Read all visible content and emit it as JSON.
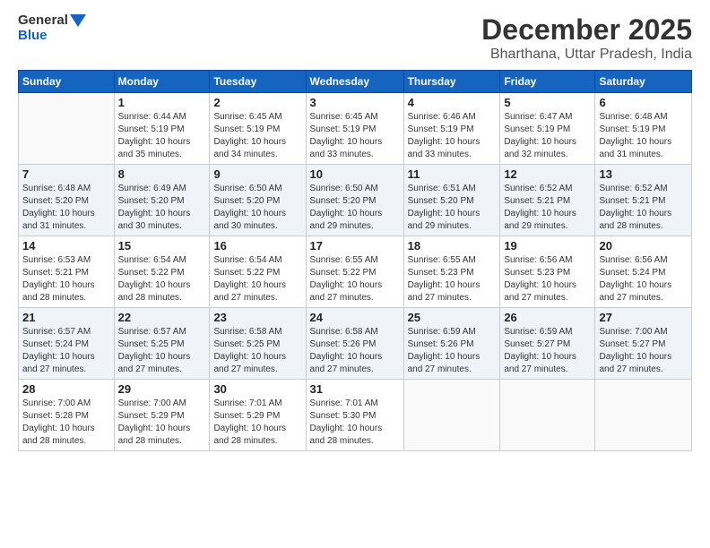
{
  "logo": {
    "line1": "General",
    "line2": "Blue"
  },
  "title": "December 2025",
  "subtitle": "Bharthana, Uttar Pradesh, India",
  "weekdays": [
    "Sunday",
    "Monday",
    "Tuesday",
    "Wednesday",
    "Thursday",
    "Friday",
    "Saturday"
  ],
  "rows": [
    [
      {
        "day": "",
        "info": ""
      },
      {
        "day": "1",
        "info": "Sunrise: 6:44 AM\nSunset: 5:19 PM\nDaylight: 10 hours\nand 35 minutes."
      },
      {
        "day": "2",
        "info": "Sunrise: 6:45 AM\nSunset: 5:19 PM\nDaylight: 10 hours\nand 34 minutes."
      },
      {
        "day": "3",
        "info": "Sunrise: 6:45 AM\nSunset: 5:19 PM\nDaylight: 10 hours\nand 33 minutes."
      },
      {
        "day": "4",
        "info": "Sunrise: 6:46 AM\nSunset: 5:19 PM\nDaylight: 10 hours\nand 33 minutes."
      },
      {
        "day": "5",
        "info": "Sunrise: 6:47 AM\nSunset: 5:19 PM\nDaylight: 10 hours\nand 32 minutes."
      },
      {
        "day": "6",
        "info": "Sunrise: 6:48 AM\nSunset: 5:19 PM\nDaylight: 10 hours\nand 31 minutes."
      }
    ],
    [
      {
        "day": "7",
        "info": "Sunrise: 6:48 AM\nSunset: 5:20 PM\nDaylight: 10 hours\nand 31 minutes."
      },
      {
        "day": "8",
        "info": "Sunrise: 6:49 AM\nSunset: 5:20 PM\nDaylight: 10 hours\nand 30 minutes."
      },
      {
        "day": "9",
        "info": "Sunrise: 6:50 AM\nSunset: 5:20 PM\nDaylight: 10 hours\nand 30 minutes."
      },
      {
        "day": "10",
        "info": "Sunrise: 6:50 AM\nSunset: 5:20 PM\nDaylight: 10 hours\nand 29 minutes."
      },
      {
        "day": "11",
        "info": "Sunrise: 6:51 AM\nSunset: 5:20 PM\nDaylight: 10 hours\nand 29 minutes."
      },
      {
        "day": "12",
        "info": "Sunrise: 6:52 AM\nSunset: 5:21 PM\nDaylight: 10 hours\nand 29 minutes."
      },
      {
        "day": "13",
        "info": "Sunrise: 6:52 AM\nSunset: 5:21 PM\nDaylight: 10 hours\nand 28 minutes."
      }
    ],
    [
      {
        "day": "14",
        "info": "Sunrise: 6:53 AM\nSunset: 5:21 PM\nDaylight: 10 hours\nand 28 minutes."
      },
      {
        "day": "15",
        "info": "Sunrise: 6:54 AM\nSunset: 5:22 PM\nDaylight: 10 hours\nand 28 minutes."
      },
      {
        "day": "16",
        "info": "Sunrise: 6:54 AM\nSunset: 5:22 PM\nDaylight: 10 hours\nand 27 minutes."
      },
      {
        "day": "17",
        "info": "Sunrise: 6:55 AM\nSunset: 5:22 PM\nDaylight: 10 hours\nand 27 minutes."
      },
      {
        "day": "18",
        "info": "Sunrise: 6:55 AM\nSunset: 5:23 PM\nDaylight: 10 hours\nand 27 minutes."
      },
      {
        "day": "19",
        "info": "Sunrise: 6:56 AM\nSunset: 5:23 PM\nDaylight: 10 hours\nand 27 minutes."
      },
      {
        "day": "20",
        "info": "Sunrise: 6:56 AM\nSunset: 5:24 PM\nDaylight: 10 hours\nand 27 minutes."
      }
    ],
    [
      {
        "day": "21",
        "info": "Sunrise: 6:57 AM\nSunset: 5:24 PM\nDaylight: 10 hours\nand 27 minutes."
      },
      {
        "day": "22",
        "info": "Sunrise: 6:57 AM\nSunset: 5:25 PM\nDaylight: 10 hours\nand 27 minutes."
      },
      {
        "day": "23",
        "info": "Sunrise: 6:58 AM\nSunset: 5:25 PM\nDaylight: 10 hours\nand 27 minutes."
      },
      {
        "day": "24",
        "info": "Sunrise: 6:58 AM\nSunset: 5:26 PM\nDaylight: 10 hours\nand 27 minutes."
      },
      {
        "day": "25",
        "info": "Sunrise: 6:59 AM\nSunset: 5:26 PM\nDaylight: 10 hours\nand 27 minutes."
      },
      {
        "day": "26",
        "info": "Sunrise: 6:59 AM\nSunset: 5:27 PM\nDaylight: 10 hours\nand 27 minutes."
      },
      {
        "day": "27",
        "info": "Sunrise: 7:00 AM\nSunset: 5:27 PM\nDaylight: 10 hours\nand 27 minutes."
      }
    ],
    [
      {
        "day": "28",
        "info": "Sunrise: 7:00 AM\nSunset: 5:28 PM\nDaylight: 10 hours\nand 28 minutes."
      },
      {
        "day": "29",
        "info": "Sunrise: 7:00 AM\nSunset: 5:29 PM\nDaylight: 10 hours\nand 28 minutes."
      },
      {
        "day": "30",
        "info": "Sunrise: 7:01 AM\nSunset: 5:29 PM\nDaylight: 10 hours\nand 28 minutes."
      },
      {
        "day": "31",
        "info": "Sunrise: 7:01 AM\nSunset: 5:30 PM\nDaylight: 10 hours\nand 28 minutes."
      },
      {
        "day": "",
        "info": ""
      },
      {
        "day": "",
        "info": ""
      },
      {
        "day": "",
        "info": ""
      }
    ]
  ]
}
